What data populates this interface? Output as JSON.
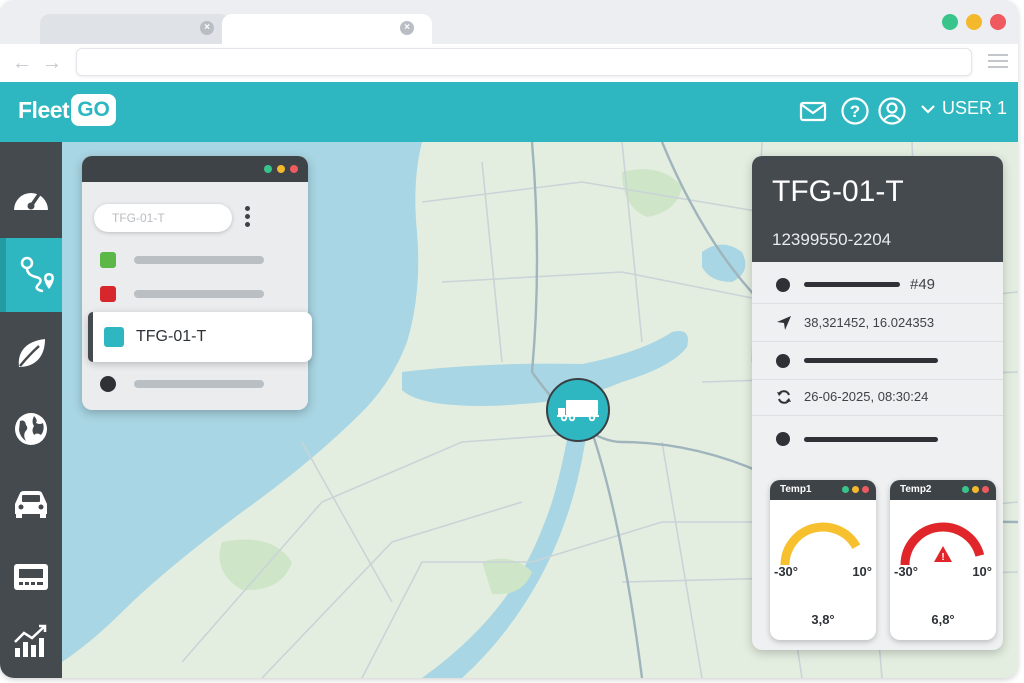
{
  "app": {
    "logo_text": "Fleet",
    "logo_badge": "GO"
  },
  "header": {
    "user_label": "USER 1",
    "icons": [
      "mail-icon",
      "help-icon",
      "user-icon",
      "chevron-down-icon"
    ]
  },
  "sidebar": {
    "items": [
      {
        "icon": "speedometer-icon"
      },
      {
        "icon": "route-icon",
        "active": true
      },
      {
        "icon": "leaf-icon"
      },
      {
        "icon": "globe-icon"
      },
      {
        "icon": "car-icon"
      },
      {
        "icon": "terminal-icon"
      },
      {
        "icon": "chart-icon"
      }
    ]
  },
  "vehicle_list": {
    "search_value": "TFG-01-T",
    "items": [
      {
        "status_color": "#5bb846"
      },
      {
        "status_color": "#d8262d"
      },
      {
        "label": "TFG-01-T",
        "status_color": "#2fb7c1",
        "selected": true
      },
      {
        "status_color": "#2e3236"
      }
    ]
  },
  "details": {
    "vehicle_id": "TFG-01-T",
    "vehicle_number": "12399550-2204",
    "trip_number": "#49",
    "coordinates": "38,321452, 16.024353",
    "last_update": "26-06-2025, 08:30:24"
  },
  "sensors": [
    {
      "label": "Temp1",
      "min": "-30°",
      "max": "10°",
      "value": "3,8°",
      "level": 0.84,
      "color": "#f7c02e",
      "alert": false
    },
    {
      "label": "Temp2",
      "min": "-30°",
      "max": "10°",
      "value": "6,8°",
      "level": 0.92,
      "color": "#e0262b",
      "alert": true
    }
  ],
  "colors": {
    "accent": "#2fb7c1",
    "dark": "#454a4f",
    "ok": "#5bb846",
    "alert": "#d8262d"
  }
}
